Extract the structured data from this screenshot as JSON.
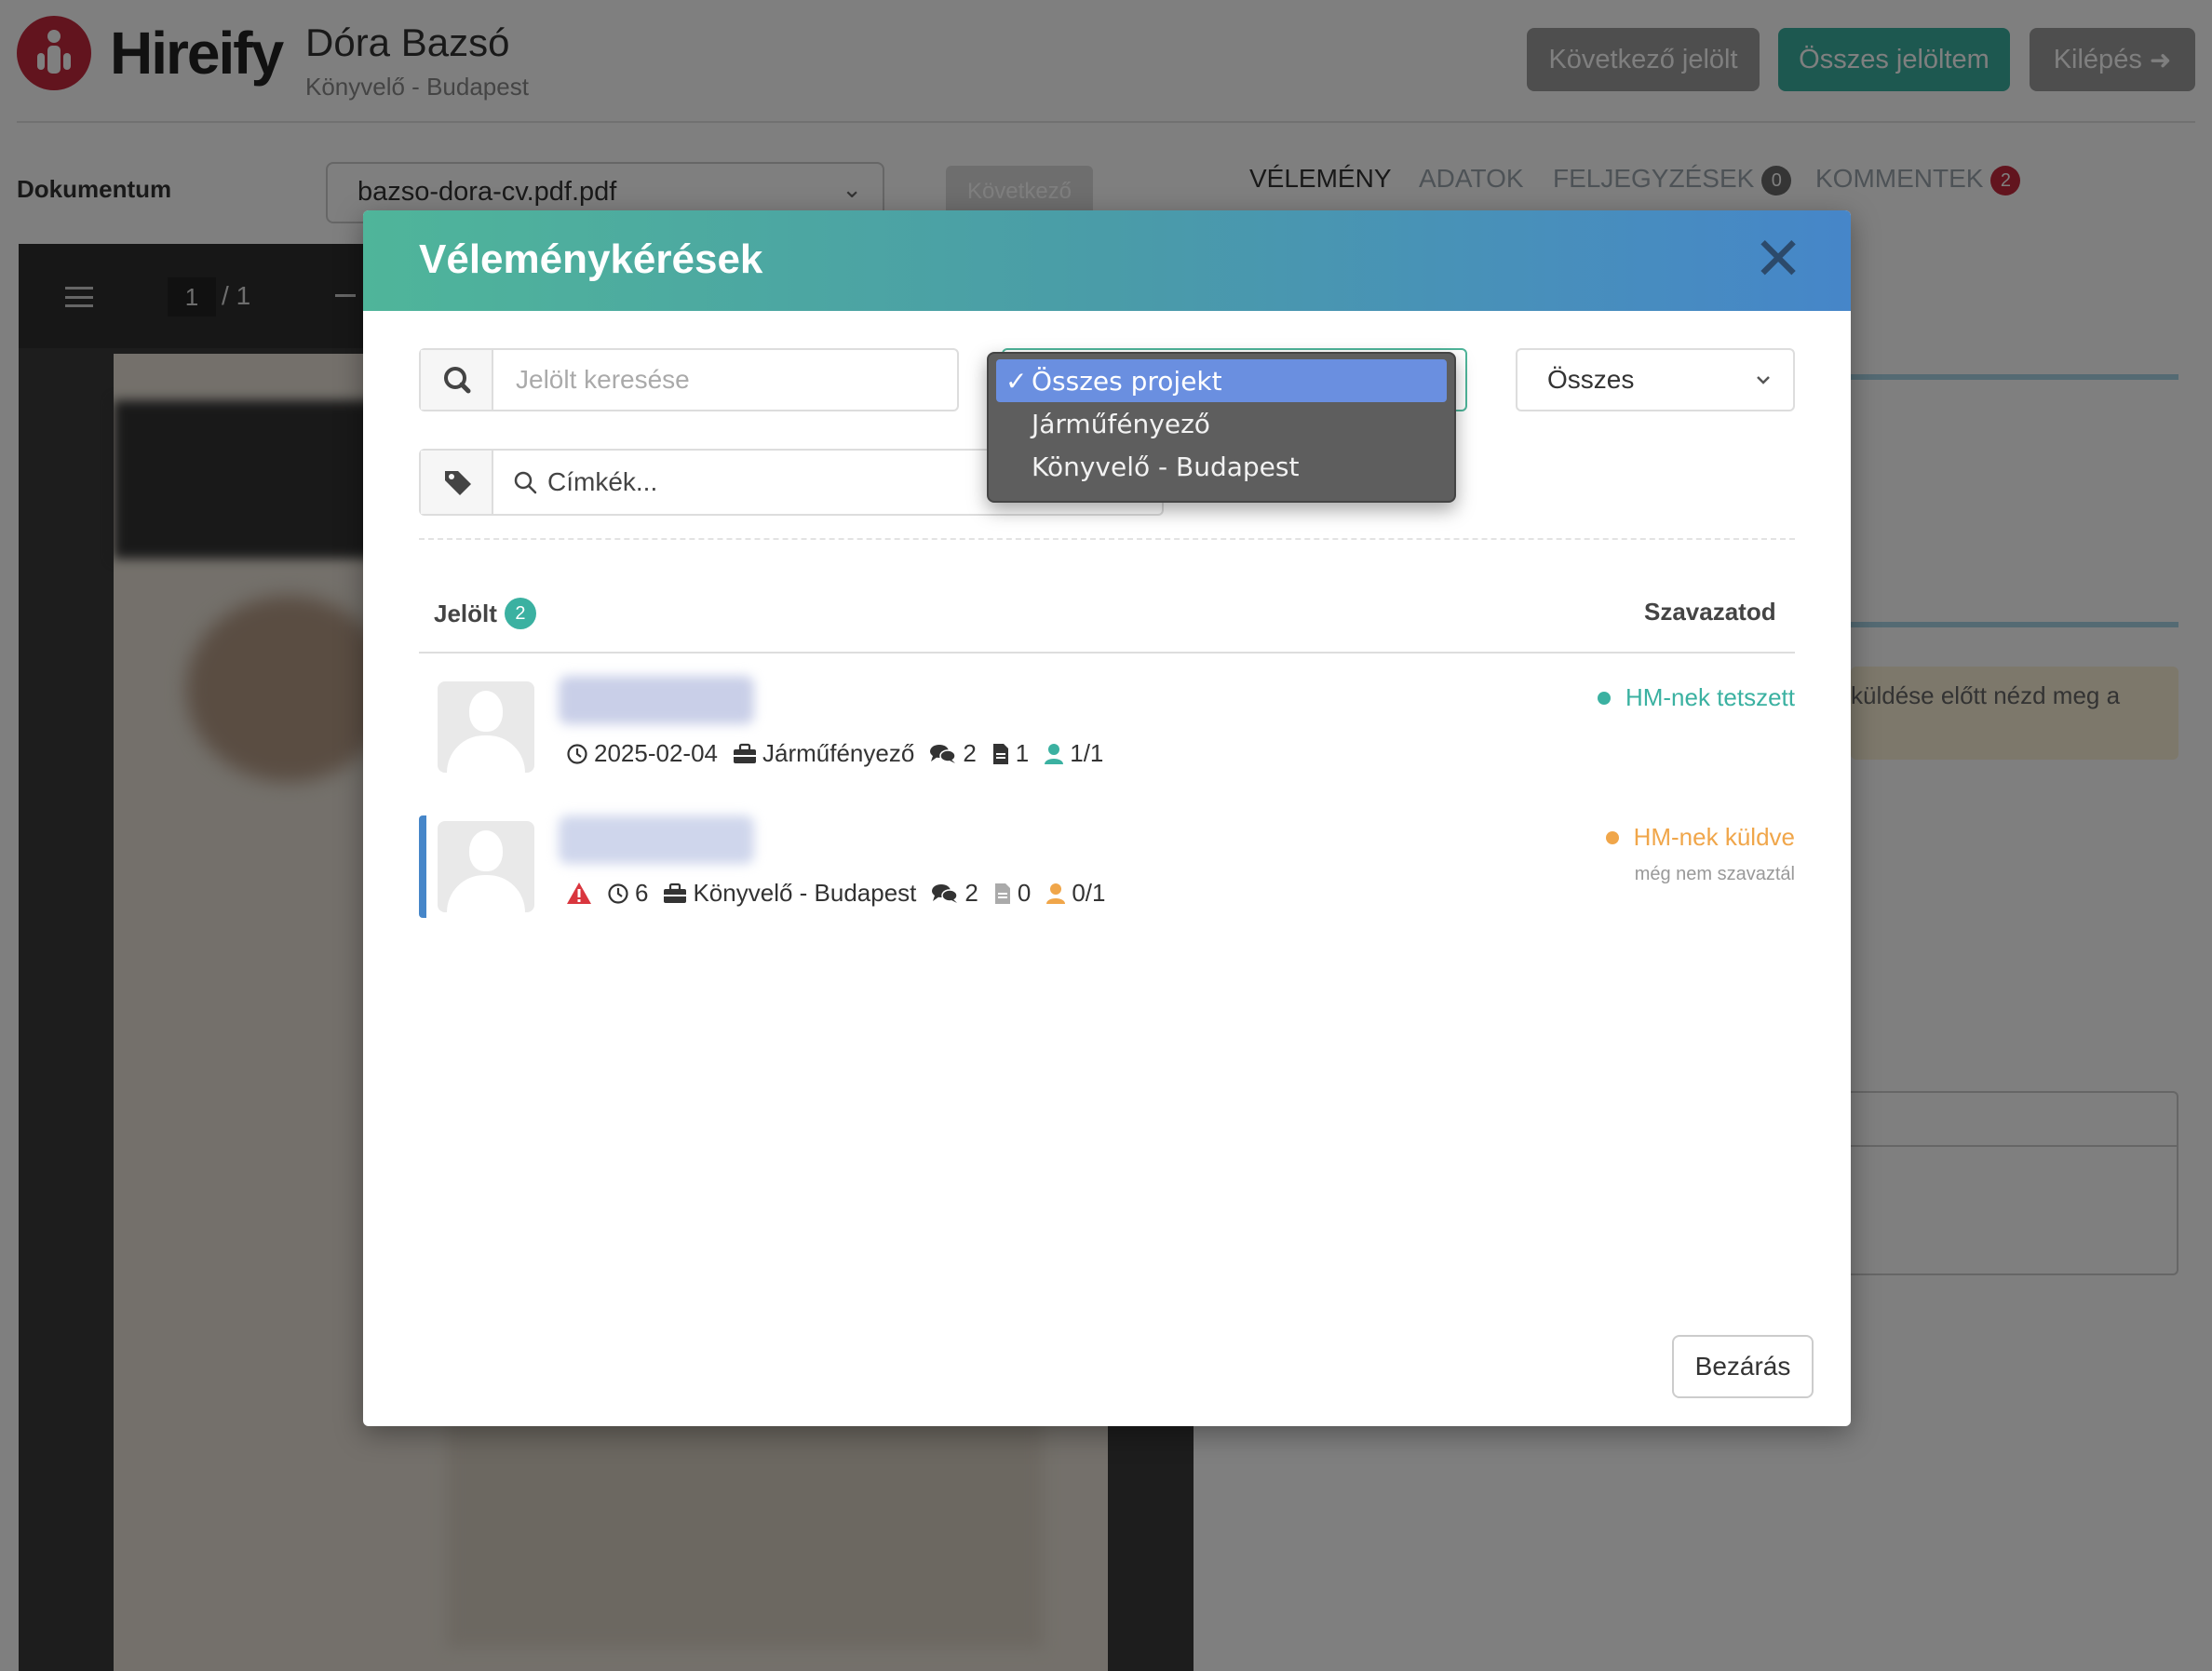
{
  "header": {
    "logo_text": "Hireify",
    "candidate_name": "Dóra Bazsó",
    "candidate_subtitle": "Könyvelő - Budapest",
    "buttons": {
      "next_candidate": "Következő jelölt",
      "all_candidates": "Összes jelöltem",
      "logout": "Kilépés"
    }
  },
  "document": {
    "label": "Dokumentum",
    "selected_file": "bazso-dora-cv.pdf.pdf",
    "next_label": "Következő"
  },
  "tabs": [
    {
      "label": "VÉLEMÉNY",
      "active": true
    },
    {
      "label": "ADATOK",
      "active": false
    },
    {
      "label": "FELJEGYZÉSEK",
      "badge": "0",
      "badge_color": "#6b6b6b"
    },
    {
      "label": "KOMMENTEK",
      "badge": "2",
      "badge_color": "#c5283d"
    }
  ],
  "pdf_viewer": {
    "current_page": "1",
    "page_separator": "/",
    "total_pages": "1"
  },
  "right_panel": {
    "warning_text": "küldése előtt nézd meg a"
  },
  "modal": {
    "title": "Véleménykérések",
    "search_placeholder": "Jelölt keresése",
    "tags_placeholder": "Címkék...",
    "project_dropdown": {
      "options": [
        "Összes projekt",
        "Járműfényező",
        "Könyvelő - Budapest"
      ],
      "selected": "Összes projekt"
    },
    "status_select": "Összes",
    "table": {
      "col_candidate": "Jelölt",
      "candidate_count": "2",
      "col_vote": "Szavazatod"
    },
    "rows": [
      {
        "date": "2025-02-04",
        "project": "Járműfényező",
        "comments": "2",
        "documents": "1",
        "votes": "1/1",
        "status": "HM-nek tetszett",
        "status_color": "#3bb1a1",
        "status_sub": ""
      },
      {
        "warning": true,
        "days": "6",
        "project": "Könyvelő - Budapest",
        "comments": "2",
        "documents": "0",
        "votes": "0/1",
        "status": "HM-nek küldve",
        "status_color": "#f0a64a",
        "status_sub": "még nem szavaztál"
      }
    ],
    "close_button": "Bezárás"
  },
  "colors": {
    "brand_red": "#c5283d",
    "teal": "#3bb1a1",
    "orange": "#f0a64a",
    "header_gradient_start": "#4fb59a",
    "header_gradient_end": "#4686c9"
  }
}
